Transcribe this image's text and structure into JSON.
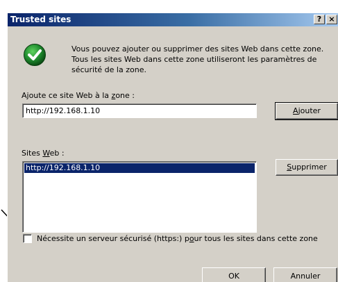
{
  "window": {
    "title": "Trusted sites",
    "help_glyph": "?",
    "close_glyph": "×"
  },
  "info": {
    "icon": "green-check-circle-icon",
    "text": "Vous pouvez ajouter ou supprimer des sites Web dans cette zone. Tous les sites Web dans cette zone utiliseront les paramètres de sécurité de la zone."
  },
  "add_section": {
    "label_pre": "Ajoute ce site Web à la ",
    "label_accel": "z",
    "label_post": "one :",
    "input_value": "http://192.168.1.10",
    "button_accel": "A",
    "button_rest": "jouter"
  },
  "sites_section": {
    "label_pre": "Sites ",
    "label_accel": "W",
    "label_post": "eb :",
    "items": [
      "http://192.168.1.10"
    ],
    "remove_accel": "S",
    "remove_rest": "upprimer"
  },
  "https_option": {
    "checked": false,
    "label_pre": "Nécessite un serveur sécurisé (https:) p",
    "label_accel": "o",
    "label_post": "ur tous les sites dans cette zone"
  },
  "footer": {
    "ok_label": "OK",
    "cancel_label": "Annuler"
  },
  "colors": {
    "title_bar": "#0a246a",
    "dialog_bg": "#d4d0c8",
    "selection": "#0a246a",
    "check_green": "#1f8a2e"
  }
}
